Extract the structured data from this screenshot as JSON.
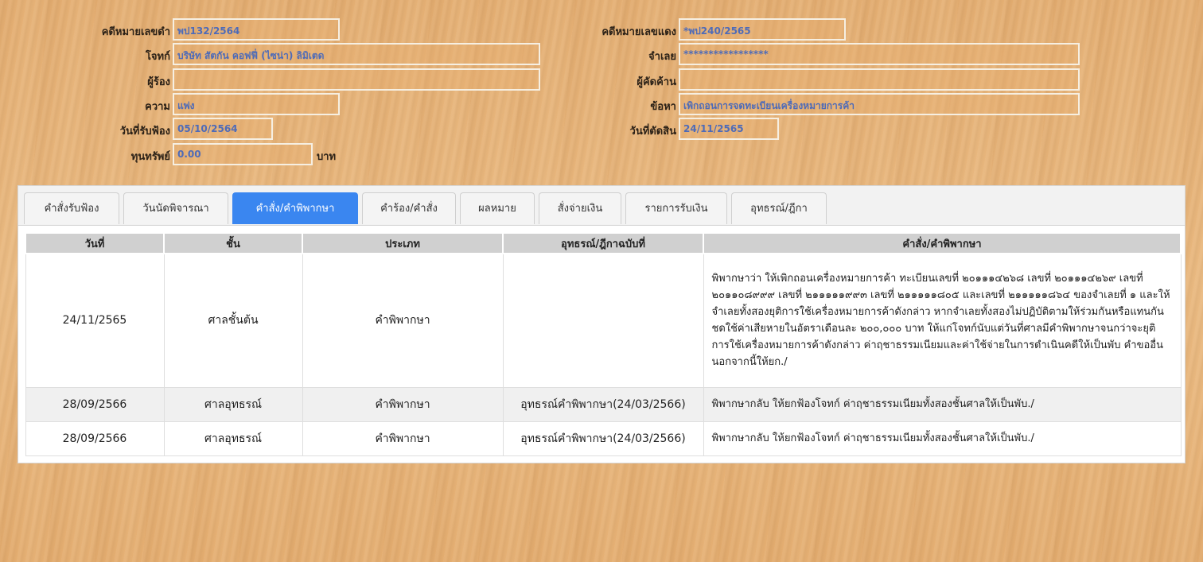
{
  "case": {
    "black_no_label": "คดีหมายเลขดำ",
    "black_no": "พป132/2564",
    "red_no_label": "คดีหมายเลขแดง",
    "red_no": "*พป240/2565",
    "plaintiff_label": "โจทก์",
    "plaintiff": "บริษัท สัตกัน คอฟฟี่ (ไซน่า) ลิมิเตด",
    "defendant_label": "จำเลย",
    "defendant": "*****************",
    "petitioner_label": "ผู้ร้อง",
    "petitioner": "",
    "objector_label": "ผู้คัดค้าน",
    "objector": "",
    "matter_label": "ความ",
    "matter": "แพ่ง",
    "charge_label": "ข้อหา",
    "charge": "เพิกถอนการจดทะเบียนเครื่องหมายการค้า",
    "filed_date_label": "วันที่รับฟ้อง",
    "filed_date": "05/10/2564",
    "decided_date_label": "วันที่ตัดสิน",
    "decided_date": "24/11/2565",
    "capital_label": "ทุนทรัพย์",
    "capital": "0.00",
    "capital_unit": "บาท"
  },
  "tabs": [
    {
      "label": "คำสั่งรับฟ้อง"
    },
    {
      "label": "วันนัดพิจารณา"
    },
    {
      "label": "คำสั่ง/คำพิพากษา"
    },
    {
      "label": "คำร้อง/คำสั่ง"
    },
    {
      "label": "ผลหมาย"
    },
    {
      "label": "สั่งจ่ายเงิน"
    },
    {
      "label": "รายการรับเงิน"
    },
    {
      "label": "อุทธรณ์/ฎีกา"
    }
  ],
  "active_tab": "คำสั่ง/คำพิพากษา",
  "accent_color": "#3a86f0",
  "table": {
    "headers": [
      "วันที่",
      "ชั้น",
      "ประเภท",
      "อุทธรณ์/ฎีกาฉบับที่",
      "คำสั่ง/คำพิพากษา"
    ],
    "rows": [
      {
        "date": "24/11/2565",
        "level": "ศาลชั้นต้น",
        "type": "คำพิพากษา",
        "appeal_no": "",
        "judgment": "พิพากษาว่า ให้เพิกถอนเครื่องหมายการค้า ทะเบียนเลขที่ ๒๐๑๑๑๔๒๖๘ เลขที่ ๒๐๑๑๑๔๒๖๙ เลขที่ ๒๐๑๑๐๘๙๙๙ เลขที่ ๒๑๑๑๑๑๙๙๓ เลขที่ ๒๑๑๑๑๑๘๐๕ และเลขที่ ๒๑๑๑๑๑๘๖๔ ของจำเลยที่ ๑ และให้จำเลยทั้งสองยุติการใช้เครื่องหมายการค้าดังกล่าว หากจำเลยทั้งสองไม่ปฏิบัติตามให้ร่วมกันหรือแทนกันชดใช้ค่าเสียหายในอัตราเดือนละ ๒๐๐,๐๐๐ บาท ให้แก่โจทก์นับแต่วันที่ศาลมีคำพิพากษาจนกว่าจะยุติการใช้เครื่องหมายการค้าดังกล่าว ค่าฤชาธรรมเนียมและค่าใช้จ่ายในการดำเนินคดีให้เป็นพับ คำขออื่นนอกจากนี้ให้ยก./"
      },
      {
        "date": "28/09/2566",
        "level": "ศาลอุทธรณ์",
        "type": "คำพิพากษา",
        "appeal_no": "อุทธรณ์คำพิพากษา(24/03/2566)",
        "judgment": "พิพากษากลับ ให้ยกฟ้องโจทก์ ค่าฤชาธรรมเนียมทั้งสองชั้นศาลให้เป็นพับ./"
      },
      {
        "date": "28/09/2566",
        "level": "ศาลอุทธรณ์",
        "type": "คำพิพากษา",
        "appeal_no": "อุทธรณ์คำพิพากษา(24/03/2566)",
        "judgment": "พิพากษากลับ ให้ยกฟ้องโจทก์ ค่าฤชาธรรมเนียมทั้งสองชั้นศาลให้เป็นพับ./"
      }
    ]
  }
}
